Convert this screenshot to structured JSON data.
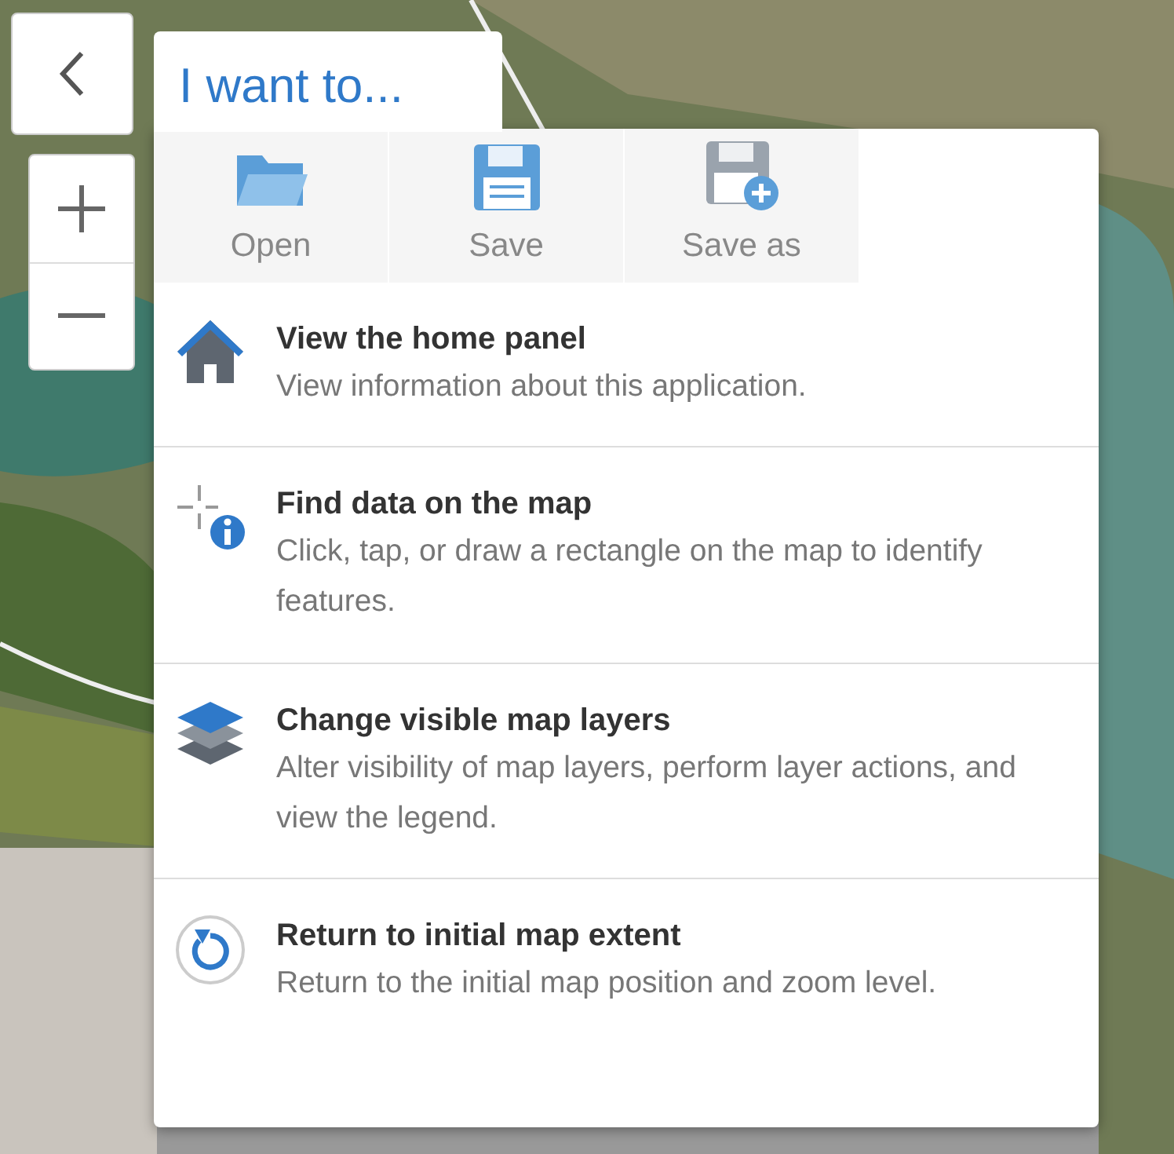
{
  "menu": {
    "title": "I want to...",
    "actions": [
      {
        "label": "Open",
        "kind": "open"
      },
      {
        "label": "Save",
        "kind": "save"
      },
      {
        "label": "Save as",
        "kind": "save-as"
      }
    ],
    "items": [
      {
        "kind": "home",
        "title": "View the home panel",
        "description": "View information about this application."
      },
      {
        "kind": "identify",
        "title": "Find data on the map",
        "description": "Click, tap, or draw a rectangle on the map to identify features."
      },
      {
        "kind": "layers",
        "title": "Change visible map layers",
        "description": "Alter visibility of map layers, perform layer actions, and view the legend."
      },
      {
        "kind": "extent",
        "title": "Return to initial map extent",
        "description": "Return to the initial map position and zoom level."
      }
    ]
  }
}
